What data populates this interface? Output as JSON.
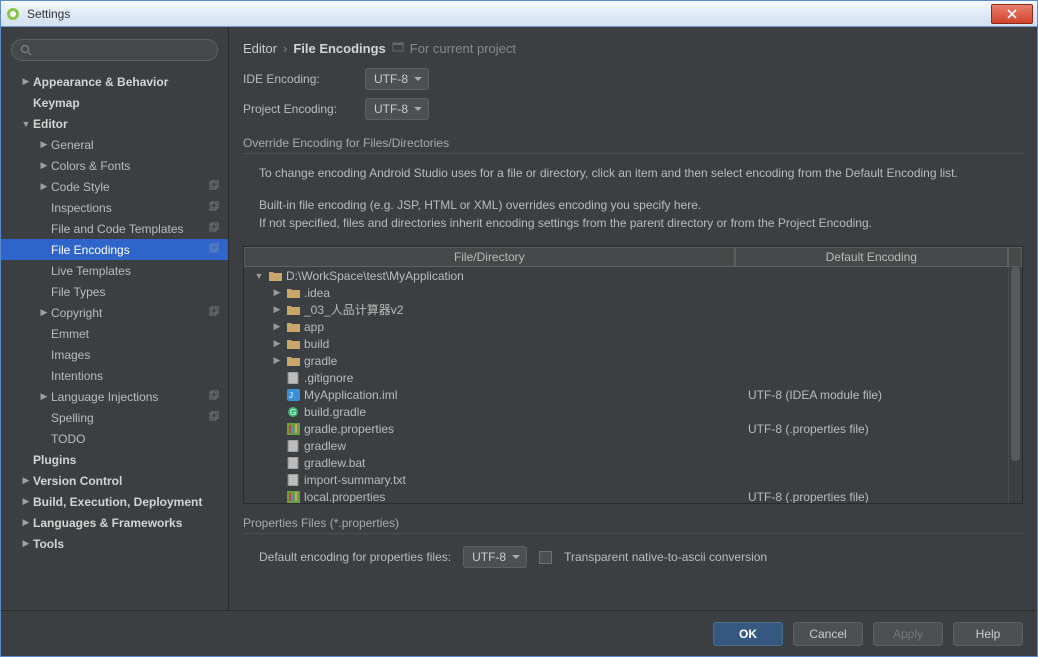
{
  "window": {
    "title": "Settings"
  },
  "sidebar": {
    "search_placeholder": "",
    "items": [
      {
        "label": "Appearance & Behavior",
        "indent": 0,
        "arrow": "right",
        "bold": true,
        "copy": false
      },
      {
        "label": "Keymap",
        "indent": 0,
        "arrow": "",
        "bold": true,
        "copy": false
      },
      {
        "label": "Editor",
        "indent": 0,
        "arrow": "down",
        "bold": true,
        "copy": false
      },
      {
        "label": "General",
        "indent": 1,
        "arrow": "right",
        "bold": false,
        "copy": false
      },
      {
        "label": "Colors & Fonts",
        "indent": 1,
        "arrow": "right",
        "bold": false,
        "copy": false
      },
      {
        "label": "Code Style",
        "indent": 1,
        "arrow": "right",
        "bold": false,
        "copy": true
      },
      {
        "label": "Inspections",
        "indent": 1,
        "arrow": "",
        "bold": false,
        "copy": true
      },
      {
        "label": "File and Code Templates",
        "indent": 1,
        "arrow": "",
        "bold": false,
        "copy": true
      },
      {
        "label": "File Encodings",
        "indent": 1,
        "arrow": "",
        "bold": false,
        "copy": true,
        "selected": true
      },
      {
        "label": "Live Templates",
        "indent": 1,
        "arrow": "",
        "bold": false,
        "copy": false
      },
      {
        "label": "File Types",
        "indent": 1,
        "arrow": "",
        "bold": false,
        "copy": false
      },
      {
        "label": "Copyright",
        "indent": 1,
        "arrow": "right",
        "bold": false,
        "copy": true
      },
      {
        "label": "Emmet",
        "indent": 1,
        "arrow": "",
        "bold": false,
        "copy": false
      },
      {
        "label": "Images",
        "indent": 1,
        "arrow": "",
        "bold": false,
        "copy": false
      },
      {
        "label": "Intentions",
        "indent": 1,
        "arrow": "",
        "bold": false,
        "copy": false
      },
      {
        "label": "Language Injections",
        "indent": 1,
        "arrow": "right",
        "bold": false,
        "copy": true
      },
      {
        "label": "Spelling",
        "indent": 1,
        "arrow": "",
        "bold": false,
        "copy": true
      },
      {
        "label": "TODO",
        "indent": 1,
        "arrow": "",
        "bold": false,
        "copy": false
      },
      {
        "label": "Plugins",
        "indent": 0,
        "arrow": "",
        "bold": true,
        "copy": false
      },
      {
        "label": "Version Control",
        "indent": 0,
        "arrow": "right",
        "bold": true,
        "copy": false
      },
      {
        "label": "Build, Execution, Deployment",
        "indent": 0,
        "arrow": "right",
        "bold": true,
        "copy": false
      },
      {
        "label": "Languages & Frameworks",
        "indent": 0,
        "arrow": "right",
        "bold": true,
        "copy": false
      },
      {
        "label": "Tools",
        "indent": 0,
        "arrow": "right",
        "bold": true,
        "copy": false
      }
    ]
  },
  "breadcrumb": {
    "part1": "Editor",
    "part2": "File Encodings",
    "suffix": "For current project"
  },
  "encodings": {
    "ide_label": "IDE Encoding:",
    "ide_value": "UTF-8",
    "project_label": "Project Encoding:",
    "project_value": "UTF-8"
  },
  "override": {
    "section_title": "Override Encoding for Files/Directories",
    "help1": "To change encoding Android Studio uses for a file or directory, click an item and then select encoding from the Default Encoding list.",
    "help2": "Built-in file encoding (e.g. JSP, HTML or XML) overrides encoding you specify here.",
    "help3": "If not specified, files and directories inherit encoding settings from the parent directory or from the Project Encoding."
  },
  "table": {
    "col_file": "File/Directory",
    "col_enc": "Default Encoding",
    "rows": [
      {
        "indent": 0,
        "arrow": "down",
        "icon": "folder",
        "name": "D:\\WorkSpace\\test\\MyApplication",
        "enc": ""
      },
      {
        "indent": 1,
        "arrow": "right",
        "icon": "folder",
        "name": ".idea",
        "enc": ""
      },
      {
        "indent": 1,
        "arrow": "right",
        "icon": "folder",
        "name": "_03_人品计算器v2",
        "enc": ""
      },
      {
        "indent": 1,
        "arrow": "right",
        "icon": "folder",
        "name": "app",
        "enc": ""
      },
      {
        "indent": 1,
        "arrow": "right",
        "icon": "folder",
        "name": "build",
        "enc": ""
      },
      {
        "indent": 1,
        "arrow": "right",
        "icon": "folder",
        "name": "gradle",
        "enc": ""
      },
      {
        "indent": 1,
        "arrow": "",
        "icon": "file",
        "name": ".gitignore",
        "enc": ""
      },
      {
        "indent": 1,
        "arrow": "",
        "icon": "iml",
        "name": "MyApplication.iml",
        "enc": "UTF-8 (IDEA module file)"
      },
      {
        "indent": 1,
        "arrow": "",
        "icon": "gradle",
        "name": "build.gradle",
        "enc": ""
      },
      {
        "indent": 1,
        "arrow": "",
        "icon": "props",
        "name": "gradle.properties",
        "enc": "UTF-8 (.properties file)"
      },
      {
        "indent": 1,
        "arrow": "",
        "icon": "file",
        "name": "gradlew",
        "enc": ""
      },
      {
        "indent": 1,
        "arrow": "",
        "icon": "file",
        "name": "gradlew.bat",
        "enc": ""
      },
      {
        "indent": 1,
        "arrow": "",
        "icon": "file",
        "name": "import-summary.txt",
        "enc": ""
      },
      {
        "indent": 1,
        "arrow": "",
        "icon": "props",
        "name": "local.properties",
        "enc": "UTF-8 (.properties file)"
      }
    ]
  },
  "props": {
    "section_title": "Properties Files (*.properties)",
    "default_label": "Default encoding for properties files:",
    "default_value": "UTF-8",
    "checkbox_label": "Transparent native-to-ascii conversion"
  },
  "buttons": {
    "ok": "OK",
    "cancel": "Cancel",
    "apply": "Apply",
    "help": "Help"
  }
}
